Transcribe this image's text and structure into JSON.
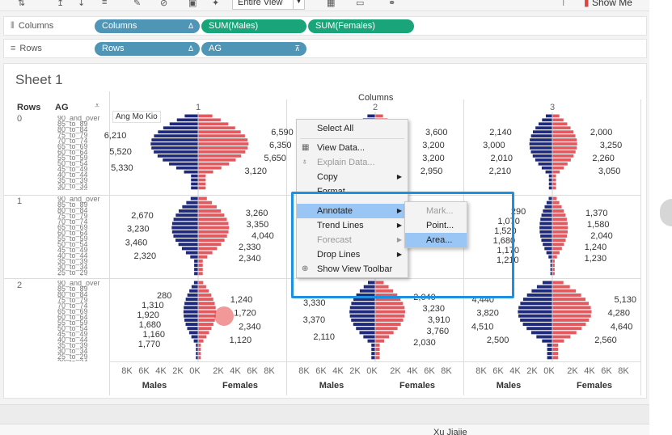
{
  "toolbar": {
    "view_mode": "Entire View",
    "show_me": "Show Me"
  },
  "shelves": {
    "columns_label": "Columns",
    "rows_label": "Rows",
    "columns_pills": [
      "Columns",
      "SUM(Males)",
      "SUM(Females)"
    ],
    "rows_pills": [
      "Rows",
      "AG"
    ]
  },
  "sheet": {
    "title": "Sheet 1",
    "col_header_rows": "Rows",
    "col_header_ag": "AG",
    "col_header_columns": "Columns",
    "panel_numbers": [
      "1",
      "2",
      "3"
    ],
    "row_numbers": [
      "0",
      "1",
      "2"
    ],
    "axis_ticks_males": [
      "8K",
      "6K",
      "4K",
      "2K",
      "0K"
    ],
    "axis_ticks_females": [
      "2K",
      "4K",
      "6K",
      "8K"
    ],
    "axis_title_males": "Males",
    "axis_title_females": "Females",
    "tooltip_label": "Ang Mo Kio",
    "ag_labels": [
      "90_and_over",
      "85_to_89",
      "80_to_84",
      "75_to_79",
      "70_to_74",
      "65_to_69",
      "60_to_64",
      "55_to_59",
      "50_to_54",
      "45_to_49",
      "40_to_44",
      "35_to_39",
      "30_to_34",
      "25_to_29",
      "20_to_24",
      "15_to_19",
      "10_to_14",
      "5_to_9",
      "0_to_4"
    ]
  },
  "chart_data": {
    "type": "bar",
    "description_units": "population count",
    "panels": [
      {
        "row": "0",
        "column": "1",
        "male_labels": [
          "6,210",
          "5,520",
          "5,330"
        ],
        "female_labels": [
          "6,590",
          "6,350",
          "5,650",
          "3,120"
        ]
      },
      {
        "row": "0",
        "column": "2",
        "male_labels": [],
        "female_labels": [
          "3,600",
          "3,200",
          "3,200",
          "2,950"
        ]
      },
      {
        "row": "0",
        "column": "3",
        "male_labels": [
          "2,140",
          "3,000",
          "2,010",
          "2,210"
        ],
        "female_labels": [
          "2,000",
          "3,250",
          "2,260",
          "3,050"
        ]
      },
      {
        "row": "1",
        "column": "1",
        "male_labels": [
          "2,670",
          "3,230",
          "3,460",
          "2,320"
        ],
        "female_labels": [
          "3,260",
          "3,350",
          "4,040",
          "2,330",
          "2,340"
        ]
      },
      {
        "row": "1",
        "column": "3",
        "male_labels": [
          "290",
          "1,070",
          "1,520",
          "1,680",
          "1,170",
          "1,210"
        ],
        "female_labels": [
          "1,370",
          "1,580",
          "2,040",
          "1,240",
          "1,230"
        ]
      },
      {
        "row": "2",
        "column": "1",
        "male_labels": [
          "280",
          "1,310",
          "1,920",
          "1,680",
          "1,160",
          "1,770"
        ],
        "female_labels": [
          "1,240",
          "1,720",
          "2,340",
          "1,120"
        ]
      },
      {
        "row": "2",
        "column": "2",
        "male_labels": [
          "3,330",
          "3,370",
          "2,110"
        ],
        "female_labels": [
          "2,040",
          "3,230",
          "3,910",
          "3,760",
          "2,030"
        ]
      },
      {
        "row": "2",
        "column": "3",
        "male_labels": [
          "4,440",
          "3,820",
          "4,510",
          "2,500"
        ],
        "female_labels": [
          "5,130",
          "4,280",
          "4,640",
          "2,560"
        ]
      }
    ],
    "x_axis_ticks": [
      "8K",
      "6K",
      "4K",
      "2K",
      "0K",
      "2K",
      "4K",
      "6K",
      "8K"
    ],
    "series": [
      {
        "name": "Males",
        "color": "#1f2a7a"
      },
      {
        "name": "Females",
        "color": "#e05a5f"
      }
    ]
  },
  "context_menu": {
    "items": [
      {
        "label": "Select All",
        "disabled": false,
        "submenu": false,
        "icon": ""
      },
      {
        "label": "View Data...",
        "disabled": false,
        "submenu": false,
        "icon": "table-icon"
      },
      {
        "label": "Explain Data...",
        "disabled": true,
        "submenu": false,
        "icon": "lightbulb-icon"
      },
      {
        "label": "Copy",
        "disabled": false,
        "submenu": true,
        "icon": ""
      },
      {
        "label": "Format...",
        "disabled": false,
        "submenu": false,
        "icon": ""
      },
      {
        "label": "Annotate",
        "disabled": false,
        "submenu": true,
        "icon": "",
        "highlighted": true
      },
      {
        "label": "Trend Lines",
        "disabled": false,
        "submenu": true,
        "icon": ""
      },
      {
        "label": "Forecast",
        "disabled": true,
        "submenu": true,
        "icon": ""
      },
      {
        "label": "Drop Lines",
        "disabled": false,
        "submenu": true,
        "icon": ""
      },
      {
        "label": "Show View Toolbar",
        "disabled": false,
        "submenu": false,
        "icon": "magnify-icon"
      }
    ],
    "submenu": [
      {
        "label": "Mark...",
        "disabled": true
      },
      {
        "label": "Point...",
        "disabled": false
      },
      {
        "label": "Area...",
        "disabled": false,
        "highlighted": true
      }
    ]
  },
  "statusbar": {
    "user": "Xu Jiajie"
  },
  "colors": {
    "males": "#1f2a7a",
    "females": "#e05a5f",
    "pill_blue": "#4e95b6",
    "pill_green": "#19a579",
    "highlight": "#99c6f4",
    "callout": "#1e90e0"
  }
}
